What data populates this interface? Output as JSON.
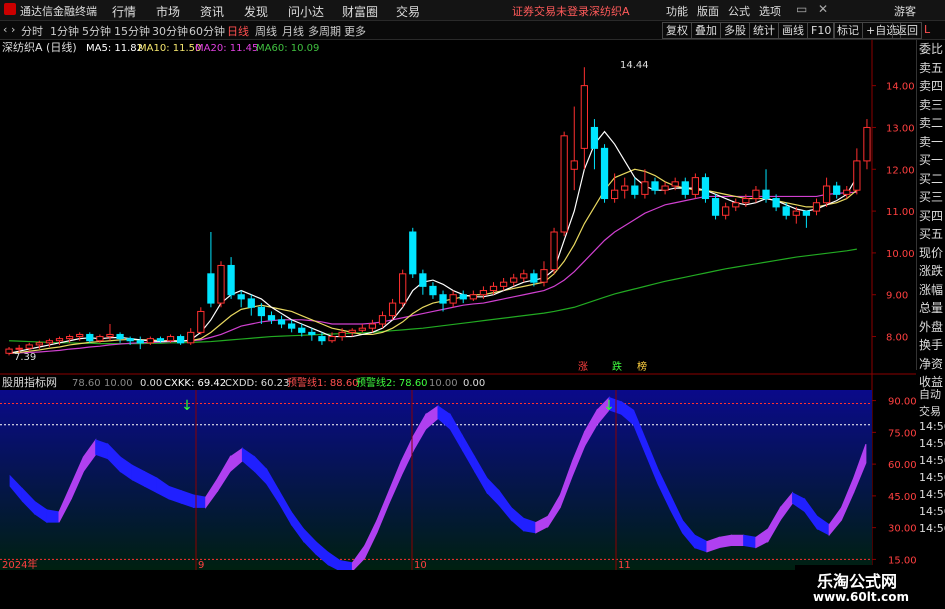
{
  "menubar": {
    "title": "通达信金融终端",
    "items": [
      "行情",
      "市场",
      "资讯",
      "发现",
      "问小达",
      "财富圈",
      "交易"
    ],
    "warning": "证券交易未登录",
    "stock": "深纺织A",
    "right": [
      "功能",
      "版面",
      "公式",
      "选项"
    ],
    "guest": "游客"
  },
  "toolbar": {
    "periods": [
      "分时",
      "1分钟",
      "5分钟",
      "15分钟",
      "30分钟",
      "60分钟",
      "日线",
      "周线",
      "月线",
      "多周期",
      "更多"
    ],
    "active": "日线",
    "right_buttons": [
      "复权",
      "叠加",
      "多股",
      "统计",
      "画线",
      "F10",
      "标记",
      "+自选",
      "返回"
    ]
  },
  "main": {
    "stock_label": "深纺织A (日线)",
    "ma5": "MA5: 11.82",
    "ma10": "MA10: 11.50",
    "ma20": "MA20: 11.45",
    "ma60": "MA60: 10.09",
    "high_marker": "14.44",
    "low_marker": "7.39",
    "yticks": [
      "14.00",
      "13.00",
      "12.00",
      "11.00",
      "10.00",
      "9.00",
      "8.00"
    ],
    "badges": [
      "涨",
      "跌",
      "榜"
    ]
  },
  "side": {
    "items": [
      "委比",
      "卖五",
      "卖四",
      "卖三",
      "卖二",
      "卖一",
      "买一",
      "买二",
      "买三",
      "买四",
      "买五",
      "现价",
      "涨跌",
      "涨幅",
      "总量",
      "外盘",
      "换手",
      "净资",
      "收益"
    ]
  },
  "indicator": {
    "name": "股朋指标网",
    "v1": "78.60",
    "v2": "10.00",
    "v3": "0.00",
    "cxkk": "CXKK: 69.42",
    "cxdd": "CXDD: 60.23",
    "warn1": "预警线1: 88.60",
    "warn2": "预警线2: 78.60",
    "v4": "10.00",
    "v5": "0.00",
    "yticks": [
      "90.00",
      "75.00",
      "60.00",
      "45.00",
      "30.00",
      "15.00"
    ],
    "right_labels": [
      "自动",
      "交易",
      "14:56",
      "14:56",
      "14:56",
      "14:56",
      "14:56",
      "14:56",
      "14:56"
    ]
  },
  "xaxis": {
    "labels": [
      "2024年",
      "9",
      "10",
      "11"
    ]
  },
  "watermark": {
    "line1": "乐淘公式网",
    "line2": "www.60lt.com"
  },
  "chart_data": {
    "type": "candlestick",
    "title": "深纺织A (日线)",
    "ylim": [
      7.2,
      14.9
    ],
    "osc_ylim": [
      10,
      95
    ],
    "candles": [
      [
        7.6,
        7.7,
        7.55,
        7.75
      ],
      [
        7.7,
        7.72,
        7.6,
        7.8
      ],
      [
        7.72,
        7.8,
        7.65,
        7.85
      ],
      [
        7.8,
        7.85,
        7.7,
        7.9
      ],
      [
        7.85,
        7.9,
        7.75,
        7.95
      ],
      [
        7.9,
        7.95,
        7.8,
        8.0
      ],
      [
        7.95,
        8.0,
        7.85,
        8.05
      ],
      [
        8.0,
        8.05,
        7.9,
        8.1
      ],
      [
        8.05,
        7.9,
        7.85,
        8.1
      ],
      [
        7.9,
        8.0,
        7.85,
        8.05
      ],
      [
        8.0,
        8.05,
        7.9,
        8.3
      ],
      [
        8.05,
        7.95,
        7.85,
        8.1
      ],
      [
        7.95,
        7.9,
        7.8,
        8.0
      ],
      [
        7.9,
        7.85,
        7.7,
        8.0
      ],
      [
        7.85,
        7.95,
        7.8,
        8.0
      ],
      [
        7.95,
        7.9,
        7.85,
        8.0
      ],
      [
        7.9,
        8.0,
        7.85,
        8.05
      ],
      [
        8.0,
        7.85,
        7.8,
        8.05
      ],
      [
        7.85,
        8.1,
        7.8,
        8.2
      ],
      [
        8.1,
        8.6,
        8.05,
        8.7
      ],
      [
        9.5,
        8.8,
        8.7,
        10.5
      ],
      [
        8.8,
        9.7,
        8.7,
        9.8
      ],
      [
        9.7,
        9.0,
        8.9,
        9.9
      ],
      [
        9.0,
        8.9,
        8.7,
        9.1
      ],
      [
        8.9,
        8.7,
        8.5,
        9.0
      ],
      [
        8.7,
        8.5,
        8.3,
        8.8
      ],
      [
        8.5,
        8.4,
        8.3,
        8.6
      ],
      [
        8.4,
        8.3,
        8.2,
        8.5
      ],
      [
        8.3,
        8.2,
        8.1,
        8.4
      ],
      [
        8.2,
        8.1,
        8.0,
        8.3
      ],
      [
        8.1,
        8.05,
        7.9,
        8.2
      ],
      [
        8.0,
        7.9,
        7.8,
        8.1
      ],
      [
        7.9,
        8.0,
        7.85,
        8.1
      ],
      [
        8.0,
        8.1,
        7.9,
        8.2
      ],
      [
        8.1,
        8.15,
        8.0,
        8.2
      ],
      [
        8.15,
        8.2,
        8.1,
        8.3
      ],
      [
        8.2,
        8.3,
        8.1,
        8.4
      ],
      [
        8.3,
        8.5,
        8.2,
        8.6
      ],
      [
        8.5,
        8.8,
        8.4,
        8.9
      ],
      [
        8.8,
        9.5,
        8.7,
        9.6
      ],
      [
        10.5,
        9.5,
        9.4,
        10.6
      ],
      [
        9.5,
        9.2,
        9.0,
        9.6
      ],
      [
        9.2,
        9.0,
        8.9,
        9.3
      ],
      [
        9.0,
        8.8,
        8.6,
        9.1
      ],
      [
        8.8,
        9.0,
        8.7,
        9.1
      ],
      [
        9.0,
        8.9,
        8.8,
        9.1
      ],
      [
        8.9,
        9.0,
        8.85,
        9.1
      ],
      [
        9.0,
        9.1,
        8.9,
        9.2
      ],
      [
        9.1,
        9.2,
        9.0,
        9.3
      ],
      [
        9.2,
        9.3,
        9.1,
        9.4
      ],
      [
        9.3,
        9.4,
        9.2,
        9.5
      ],
      [
        9.4,
        9.5,
        9.3,
        9.6
      ],
      [
        9.5,
        9.3,
        9.2,
        9.6
      ],
      [
        9.3,
        9.6,
        9.2,
        9.8
      ],
      [
        9.6,
        10.5,
        9.5,
        10.6
      ],
      [
        10.5,
        12.8,
        10.4,
        12.9
      ],
      [
        12.0,
        12.2,
        11.5,
        13.5
      ],
      [
        12.5,
        14.0,
        12.0,
        14.44
      ],
      [
        13.0,
        12.5,
        12.0,
        13.2
      ],
      [
        12.5,
        11.3,
        11.2,
        12.6
      ],
      [
        11.3,
        11.5,
        11.2,
        11.9
      ],
      [
        11.5,
        11.6,
        11.3,
        11.8
      ],
      [
        11.6,
        11.4,
        11.3,
        11.8
      ],
      [
        11.4,
        11.7,
        11.3,
        12.0
      ],
      [
        11.7,
        11.5,
        11.4,
        11.8
      ],
      [
        11.5,
        11.6,
        11.4,
        11.7
      ],
      [
        11.6,
        11.7,
        11.5,
        11.8
      ],
      [
        11.7,
        11.4,
        11.3,
        11.8
      ],
      [
        11.4,
        11.8,
        11.3,
        11.9
      ],
      [
        11.8,
        11.3,
        11.2,
        11.9
      ],
      [
        11.3,
        10.9,
        10.8,
        11.4
      ],
      [
        10.9,
        11.1,
        10.8,
        11.2
      ],
      [
        11.1,
        11.2,
        11.0,
        11.3
      ],
      [
        11.2,
        11.3,
        11.1,
        11.4
      ],
      [
        11.3,
        11.5,
        11.2,
        11.6
      ],
      [
        11.5,
        11.3,
        11.2,
        12.0
      ],
      [
        11.3,
        11.1,
        11.0,
        11.4
      ],
      [
        11.1,
        10.9,
        10.8,
        11.2
      ],
      [
        10.9,
        11.0,
        10.7,
        11.1
      ],
      [
        11.0,
        10.9,
        10.6,
        11.0
      ],
      [
        11.0,
        11.2,
        10.9,
        11.3
      ],
      [
        11.2,
        11.6,
        11.1,
        11.8
      ],
      [
        11.6,
        11.4,
        11.3,
        11.7
      ],
      [
        11.4,
        11.5,
        11.3,
        11.6
      ],
      [
        11.5,
        12.2,
        11.4,
        12.5
      ],
      [
        12.2,
        13.0,
        12.0,
        13.2
      ]
    ],
    "ma5": [
      7.6,
      7.65,
      7.7,
      7.75,
      7.8,
      7.85,
      7.9,
      7.95,
      7.97,
      7.95,
      7.97,
      7.98,
      7.95,
      7.92,
      7.9,
      7.88,
      7.9,
      7.88,
      7.92,
      8.1,
      8.4,
      8.8,
      9.0,
      9.1,
      9.0,
      8.9,
      8.7,
      8.55,
      8.4,
      8.3,
      8.2,
      8.1,
      8.0,
      8.0,
      8.0,
      8.05,
      8.1,
      8.2,
      8.4,
      8.7,
      9.1,
      9.3,
      9.35,
      9.25,
      9.1,
      9.0,
      8.95,
      8.95,
      9.0,
      9.1,
      9.2,
      9.3,
      9.35,
      9.4,
      9.6,
      10.3,
      11.0,
      12.0,
      12.6,
      12.9,
      12.6,
      12.2,
      11.8,
      11.6,
      11.5,
      11.5,
      11.55,
      11.55,
      11.55,
      11.5,
      11.4,
      11.3,
      11.2,
      11.15,
      11.2,
      11.3,
      11.25,
      11.15,
      11.05,
      11.0,
      11.05,
      11.15,
      11.25,
      11.4,
      11.82
    ],
    "ma10": [
      7.6,
      7.62,
      7.65,
      7.68,
      7.72,
      7.75,
      7.8,
      7.83,
      7.86,
      7.88,
      7.9,
      7.92,
      7.93,
      7.92,
      7.92,
      7.9,
      7.9,
      7.9,
      7.9,
      7.95,
      8.1,
      8.3,
      8.5,
      8.65,
      8.7,
      8.75,
      8.7,
      8.65,
      8.6,
      8.5,
      8.4,
      8.3,
      8.2,
      8.15,
      8.1,
      8.05,
      8.05,
      8.1,
      8.2,
      8.35,
      8.55,
      8.7,
      8.8,
      8.85,
      8.9,
      8.95,
      9.0,
      9.0,
      9.05,
      9.1,
      9.15,
      9.2,
      9.25,
      9.3,
      9.5,
      9.8,
      10.2,
      10.7,
      11.1,
      11.5,
      11.8,
      11.9,
      12.0,
      11.95,
      11.85,
      11.7,
      11.6,
      11.55,
      11.5,
      11.5,
      11.45,
      11.4,
      11.35,
      11.3,
      11.3,
      11.3,
      11.25,
      11.2,
      11.15,
      11.1,
      11.1,
      11.15,
      11.2,
      11.3,
      11.5
    ],
    "ma20": [
      7.6,
      7.61,
      7.62,
      7.63,
      7.65,
      7.67,
      7.7,
      7.72,
      7.75,
      7.77,
      7.8,
      7.82,
      7.84,
      7.85,
      7.86,
      7.87,
      7.88,
      7.89,
      7.9,
      7.92,
      7.98,
      8.05,
      8.15,
      8.25,
      8.3,
      8.35,
      8.38,
      8.4,
      8.4,
      8.4,
      8.38,
      8.35,
      8.3,
      8.3,
      8.3,
      8.3,
      8.32,
      8.35,
      8.4,
      8.45,
      8.5,
      8.55,
      8.6,
      8.65,
      8.7,
      8.75,
      8.78,
      8.8,
      8.85,
      8.9,
      8.95,
      9.0,
      9.05,
      9.1,
      9.2,
      9.35,
      9.55,
      9.8,
      10.05,
      10.3,
      10.5,
      10.65,
      10.8,
      10.95,
      11.05,
      11.15,
      11.2,
      11.25,
      11.3,
      11.35,
      11.35,
      11.35,
      11.35,
      11.35,
      11.35,
      11.35,
      11.35,
      11.35,
      11.35,
      11.35,
      11.35,
      11.4,
      11.42,
      11.44,
      11.45
    ],
    "ma60": [
      7.9,
      7.89,
      7.88,
      7.87,
      7.86,
      7.85,
      7.85,
      7.84,
      7.84,
      7.83,
      7.83,
      7.83,
      7.83,
      7.83,
      7.84,
      7.84,
      7.85,
      7.85,
      7.86,
      7.87,
      7.88,
      7.9,
      7.92,
      7.94,
      7.96,
      7.98,
      8.0,
      8.01,
      8.02,
      8.03,
      8.04,
      8.05,
      8.06,
      8.07,
      8.08,
      8.09,
      8.1,
      8.12,
      8.14,
      8.16,
      8.18,
      8.2,
      8.23,
      8.26,
      8.29,
      8.32,
      8.35,
      8.38,
      8.41,
      8.44,
      8.47,
      8.5,
      8.53,
      8.56,
      8.6,
      8.65,
      8.7,
      8.78,
      8.86,
      8.94,
      9.02,
      9.08,
      9.14,
      9.2,
      9.26,
      9.32,
      9.37,
      9.42,
      9.47,
      9.52,
      9.57,
      9.62,
      9.66,
      9.7,
      9.74,
      9.78,
      9.82,
      9.86,
      9.9,
      9.93,
      9.96,
      9.99,
      10.02,
      10.05,
      10.09
    ],
    "osc_upper": [
      53,
      47,
      41,
      37,
      36,
      49,
      62,
      70,
      68,
      62,
      58,
      55,
      52,
      48,
      46,
      44,
      43,
      52,
      62,
      66,
      62,
      56,
      46,
      36,
      28,
      22,
      17,
      13,
      12,
      20,
      32,
      46,
      60,
      72,
      82,
      86,
      82,
      72,
      62,
      52,
      46,
      38,
      33,
      31,
      34,
      44,
      60,
      74,
      84,
      90,
      88,
      84,
      70,
      56,
      44,
      32,
      25,
      22,
      24,
      25,
      25,
      24,
      28,
      38,
      45,
      42,
      34,
      30,
      38,
      52,
      68
    ],
    "osc_lower": [
      51,
      44,
      38,
      34,
      34,
      45,
      58,
      66,
      64,
      58,
      54,
      51,
      48,
      45,
      43,
      41,
      41,
      49,
      58,
      63,
      58,
      52,
      43,
      33,
      25,
      19,
      14,
      11,
      11,
      17,
      29,
      43,
      56,
      68,
      78,
      83,
      78,
      68,
      58,
      48,
      42,
      35,
      30,
      29,
      32,
      41,
      56,
      70,
      80,
      87,
      85,
      80,
      66,
      52,
      40,
      29,
      22,
      20,
      22,
      23,
      23,
      22,
      25,
      35,
      43,
      39,
      31,
      28,
      35,
      48,
      62
    ]
  }
}
